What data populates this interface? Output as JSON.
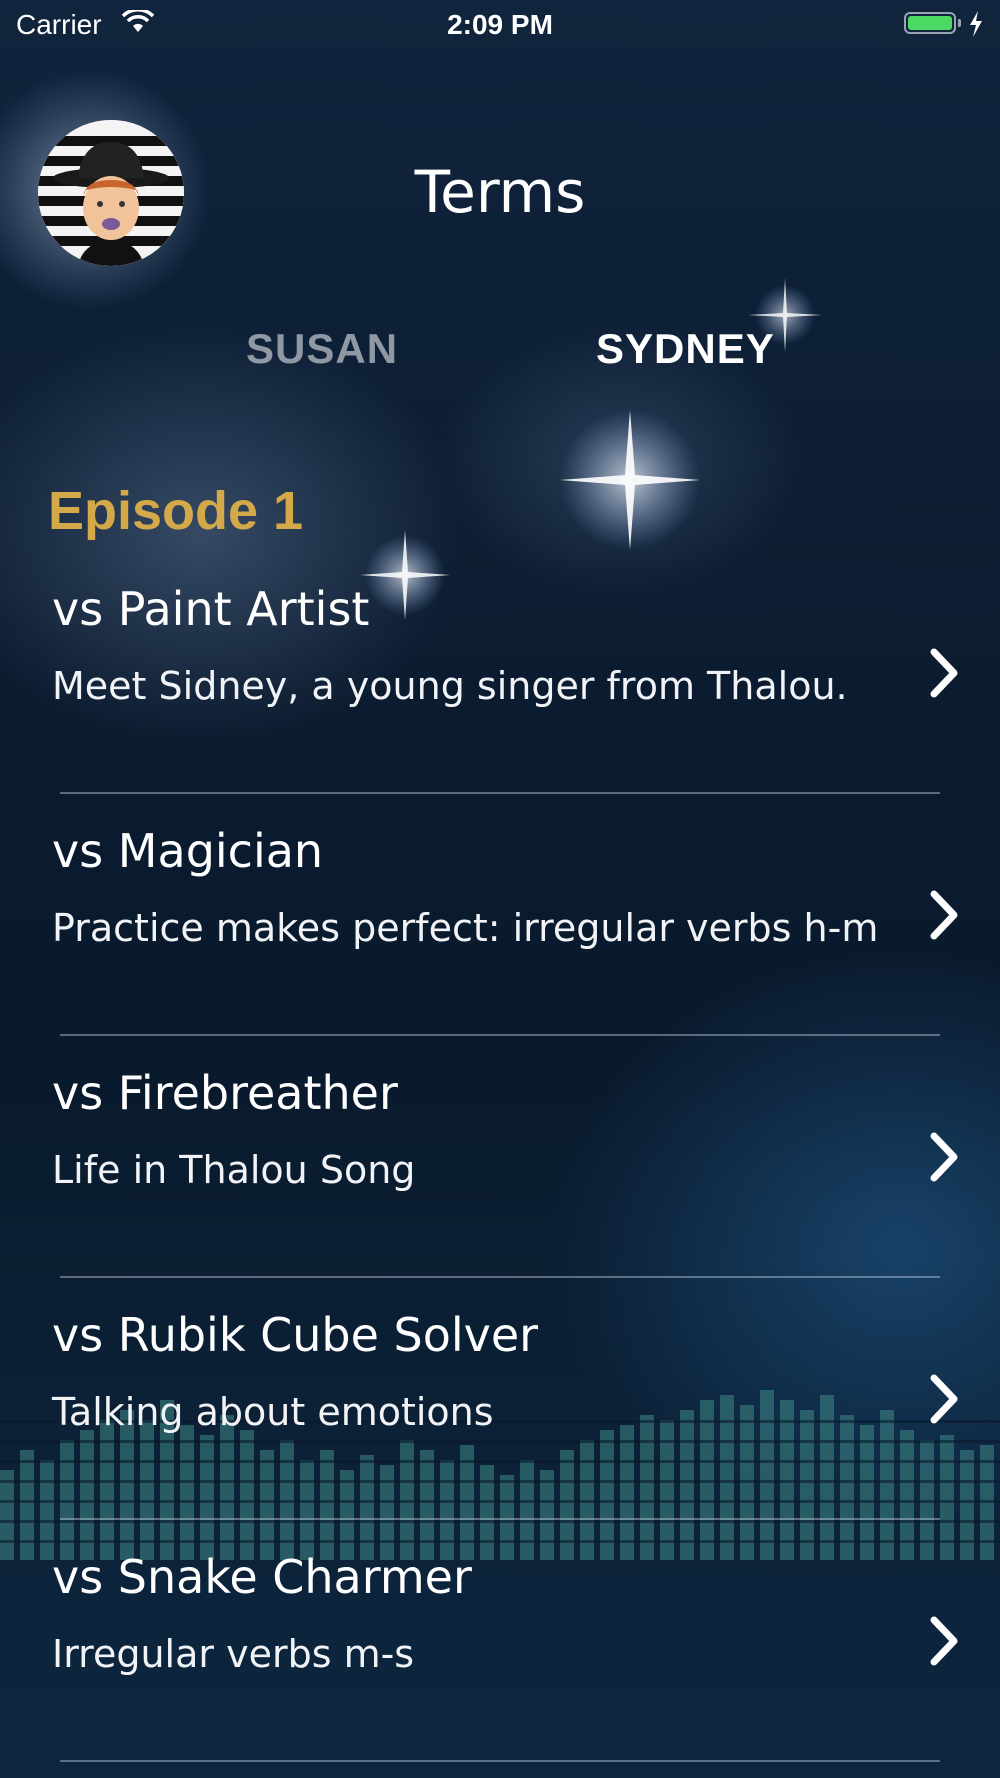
{
  "status_bar": {
    "carrier": "Carrier",
    "time": "2:09 PM",
    "battery_level": 1.0,
    "icons": [
      "wifi-icon",
      "battery-icon",
      "charging-bolt-icon"
    ]
  },
  "header": {
    "title": "Terms",
    "avatar": "profile-avatar"
  },
  "tabs": [
    {
      "label": "SUSAN",
      "selected": false
    },
    {
      "label": "SYDNEY",
      "selected": true
    }
  ],
  "episode": {
    "title": "Episode 1",
    "items": [
      {
        "title": "vs Paint Artist",
        "subtitle": "Meet Sidney, a young singer from Thalou."
      },
      {
        "title": "vs Magician",
        "subtitle": "Practice makes perfect: irregular verbs h-m"
      },
      {
        "title": "vs Firebreather",
        "subtitle": "Life in Thalou Song"
      },
      {
        "title": "vs Rubik Cube Solver",
        "subtitle": "Talking about emotions"
      },
      {
        "title": "vs Snake Charmer",
        "subtitle": "Irregular verbs m-s"
      }
    ]
  },
  "colors": {
    "accent": "#d4a94a",
    "tab_inactive": "#8f98a3",
    "tab_active": "#ffffff",
    "background": "#0b1a2e",
    "battery": "#4cd964"
  }
}
